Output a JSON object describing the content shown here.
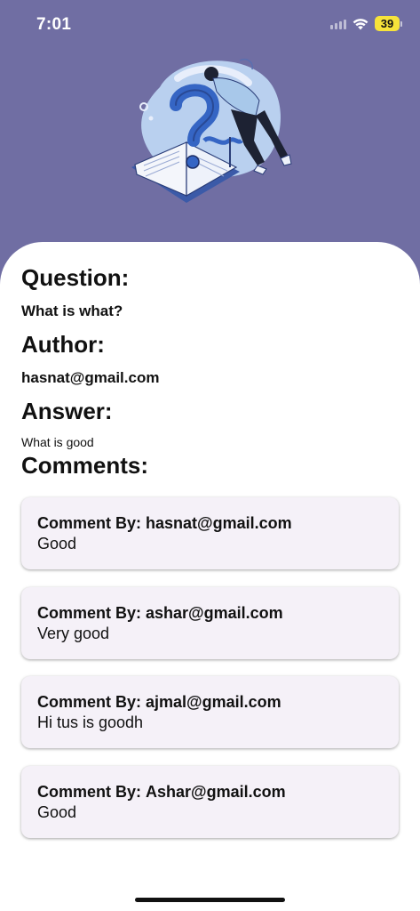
{
  "status": {
    "time": "7:01",
    "battery": "39"
  },
  "colors": {
    "header_bg": "#706ea3",
    "card_bg": "#f5f1f8"
  },
  "illustration": {
    "icon": "question-mark-book-illustration"
  },
  "question": {
    "heading": "Question:",
    "text": "What is what?"
  },
  "author": {
    "heading": "Author:",
    "email": "hasnat@gmail.com"
  },
  "answer": {
    "heading": "Answer:",
    "text": "What is good"
  },
  "comments": {
    "heading": "Comments:",
    "by_label": "Comment By:",
    "items": [
      {
        "author": "hasnat@gmail.com",
        "text": "Good"
      },
      {
        "author": "ashar@gmail.com",
        "text": "Very good"
      },
      {
        "author": "ajmal@gmail.com",
        "text": "Hi tus is goodh"
      },
      {
        "author": "Ashar@gmail.com",
        "text": "Good"
      }
    ]
  }
}
